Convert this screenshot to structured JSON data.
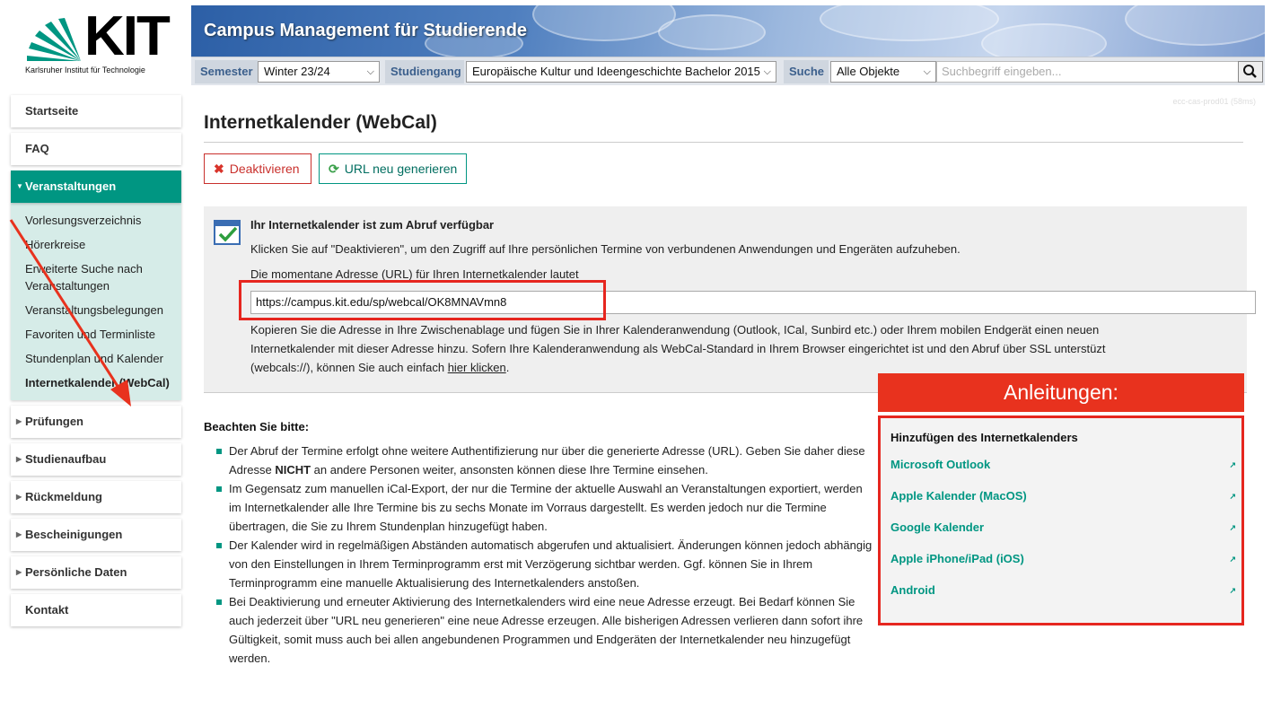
{
  "logo": {
    "text": "KIT",
    "subtitle": "Karlsruher Institut für Technologie"
  },
  "header": {
    "title": "Campus Management für Studierende"
  },
  "searchbar": {
    "semester_label": "Semester",
    "semester_value": "Winter 23/24",
    "studiengang_label": "Studiengang",
    "studiengang_value": "Europäische Kultur und Ideengeschichte Bachelor 2015",
    "suche_label": "Suche",
    "suche_scope": "Alle Objekte",
    "search_placeholder": "Suchbegriff eingeben..."
  },
  "sidebar": {
    "startseite": "Startseite",
    "faq": "FAQ",
    "veranstaltungen": "Veranstaltungen",
    "sub": [
      "Vorlesungsverzeichnis",
      "Hörerkreise",
      "Erweiterte Suche nach Veranstaltungen",
      "Veranstaltungsbelegungen",
      "Favoriten und Terminliste",
      "Stundenplan und Kalender",
      "Internetkalender (WebCal)"
    ],
    "pruefungen": "Prüfungen",
    "studienaufbau": "Studienaufbau",
    "rueckmeldung": "Rückmeldung",
    "bescheinigungen": "Bescheinigungen",
    "persoenliche_daten": "Persönliche Daten",
    "kontakt": "Kontakt"
  },
  "main": {
    "server_tag": "ecc-cas-prod01 (58ms)",
    "title": "Internetkalender (WebCal)",
    "deactivate_label": "Deaktivieren",
    "regenerate_label": "URL neu generieren",
    "info": {
      "heading": "Ihr Internetkalender ist zum Abruf verfügbar",
      "line1": "Klicken Sie auf \"Deaktivieren\", um den Zugriff auf Ihre persönlichen Termine von verbundenen Anwendungen und Engeräten aufzuheben.",
      "url_label": "Die momentane Adresse (URL) für Ihren Internetkalender lautet",
      "url": "https://campus.kit.edu/sp/webcal/OK8MNAVmn8",
      "copy1": "Kopieren Sie die Adresse in Ihre Zwischenablage und fügen Sie in Ihrer Kalenderanwendung (Outlook, ICal, Sunbird etc.) oder Ihrem mobilen Endgerät einen neuen",
      "copy2": "Internetkalender mit dieser Adresse hinzu. Sofern Ihre Kalenderanwendung als WebCal-Standard in Ihrem Browser eingerichtet ist und den Abruf über SSL unterstüzt",
      "copy3_pre": "(webcals://), können Sie auch einfach ",
      "copy3_link": "hier klicken",
      "copy3_post": "."
    },
    "anleitungen": {
      "title": "Anleitungen:",
      "heading": "Hinzufügen des Internetkalenders",
      "links": [
        "Microsoft Outlook",
        "Apple Kalender (MacOS)",
        "Google Kalender",
        "Apple iPhone/iPad (iOS)",
        "Android"
      ]
    },
    "notes": {
      "heading": "Beachten Sie bitte:",
      "n1_pre": "Der Abruf der Termine erfolgt ohne weitere Authentifizierung nur über die generierte Adresse (URL). Geben Sie daher diese Adresse ",
      "n1_bold": "NICHT",
      "n1_post": " an andere Personen weiter, ansonsten können diese Ihre Termine einsehen.",
      "n2": "Im Gegensatz zum manuellen iCal-Export, der nur die Termine der aktuelle Auswahl an Veranstaltungen exportiert, werden im Internetkalender alle Ihre Termine bis zu sechs Monate im Vorraus dargestellt. Es werden jedoch nur die Termine übertragen, die Sie zu Ihrem Stundenplan hinzugefügt haben.",
      "n3": "Der Kalender wird in regelmäßigen Abständen automatisch abgerufen und aktualisiert. Änderungen können jedoch abhängig von den Einstellungen in Ihrem Terminprogramm erst mit Verzögerung sichtbar werden. Ggf. können Sie in Ihrem Terminprogramm eine manuelle Aktualisierung des Internetkalenders anstoßen.",
      "n4": "Bei Deaktivierung und erneuter Aktivierung des Internetkalenders wird eine neue Adresse erzeugt. Bei Bedarf können Sie auch jederzeit über \"URL neu generieren\" eine neue Adresse erzeugen. Alle bisherigen Adressen verlieren dann sofort ihre Gültigkeit, somit muss auch bei allen angebundenen Programmen und Endgeräten der Internetkalender neu hinzugefügt werden."
    }
  },
  "colors": {
    "kit_green": "#009682",
    "annotation_red": "#e6261f"
  }
}
